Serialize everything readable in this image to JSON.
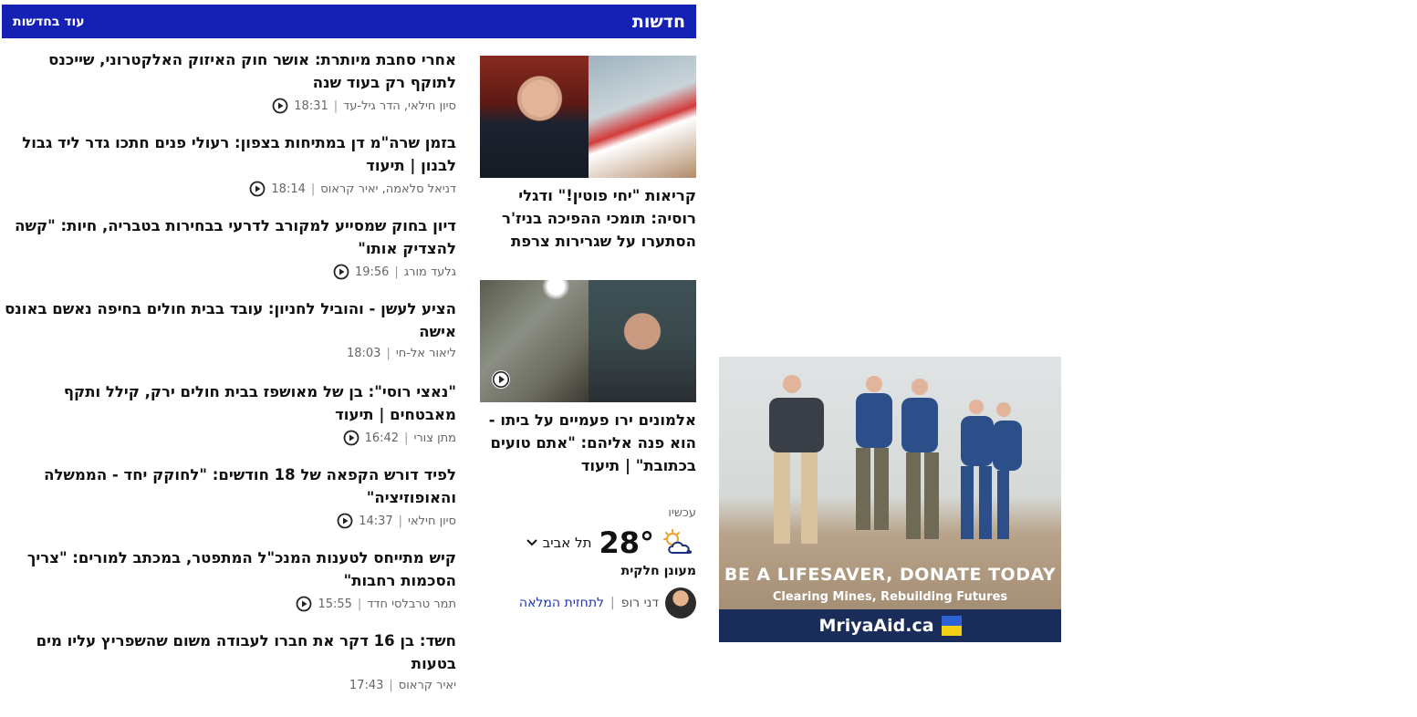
{
  "header": {
    "title": "חדשות",
    "more_label": "עוד בחדשות"
  },
  "list": [
    {
      "headline": "אחרי סחבת מיותרת: אושר חוק האיזוק האלקטרוני, שייכנס לתוקף רק בעוד שנה",
      "authors": "סיון חילאי, הדר גיל-עד",
      "time": "18:31",
      "video": true
    },
    {
      "headline": "בזמן שרה\"מ דן במתיחות בצפון: רעולי פנים חתכו גדר ליד גבול לבנון | תיעוד",
      "authors": "דניאל סלאמה, יאיר קראוס",
      "time": "18:14",
      "video": true
    },
    {
      "headline": "דיון בחוק שמסייע למקורב לדרעי בבחירות בטבריה, חיות: \"קשה להצדיק אותו\"",
      "authors": "גלעד מורג",
      "time": "19:56",
      "video": true
    },
    {
      "headline": "הציע לעשן - והוביל לחניון: עובד בבית חולים בחיפה נאשם באונס אישה",
      "authors": "ליאור אל-חי",
      "time": "18:03",
      "video": false
    },
    {
      "headline": "\"נאצי רוסי\": בן של מאושפז בבית חולים ירק, קילל ותקף מאבטחים | תיעוד",
      "authors": "מתן צורי",
      "time": "16:42",
      "video": true
    },
    {
      "headline": "לפיד דורש הקפאה של 18 חודשים: \"לחוקק יחד - הממשלה והאופוזיציה\"",
      "authors": "סיון חילאי",
      "time": "14:37",
      "video": true
    },
    {
      "headline": "קיש מתייחס לטענות המנכ\"ל המתפטר, במכתב למורים: \"צריך הסכמות רחבות\"",
      "authors": "תמר טרבלסי חדד",
      "time": "15:55",
      "video": true
    },
    {
      "headline": "חשד: בן 16 דקר את חברו לעבודה משום שהשפריץ עליו מים בטעות",
      "authors": "יאיר קראוס",
      "time": "17:43",
      "video": false
    }
  ],
  "features": [
    {
      "headline": "קריאות \"יחי פוטין!\" ודגלי רוסיה: תומכי ההפיכה בניז'ר הסתערו על שגרירות צרפת",
      "video": false
    },
    {
      "headline": "אלמונים ירו פעמיים על ביתו - הוא פנה אליהם: \"אתם טועים בכתובת\" | תיעוד",
      "video": true
    }
  ],
  "weather": {
    "now_label": "עכשיו",
    "temperature": "28°",
    "city": "תל אביב",
    "condition": "מעונן חלקית",
    "forecaster": "דני רופ",
    "forecast_link": "לתחזית המלאה"
  },
  "ad": {
    "tagline": "BE A LIFESAVER, DONATE TODAY",
    "subline": "Clearing Mines, Rebuilding Futures",
    "brand": "MriyaAid.ca"
  },
  "colors": {
    "header_bg": "#1520b4",
    "link": "#1a33b8",
    "ad_band": "#1a2d5a"
  }
}
